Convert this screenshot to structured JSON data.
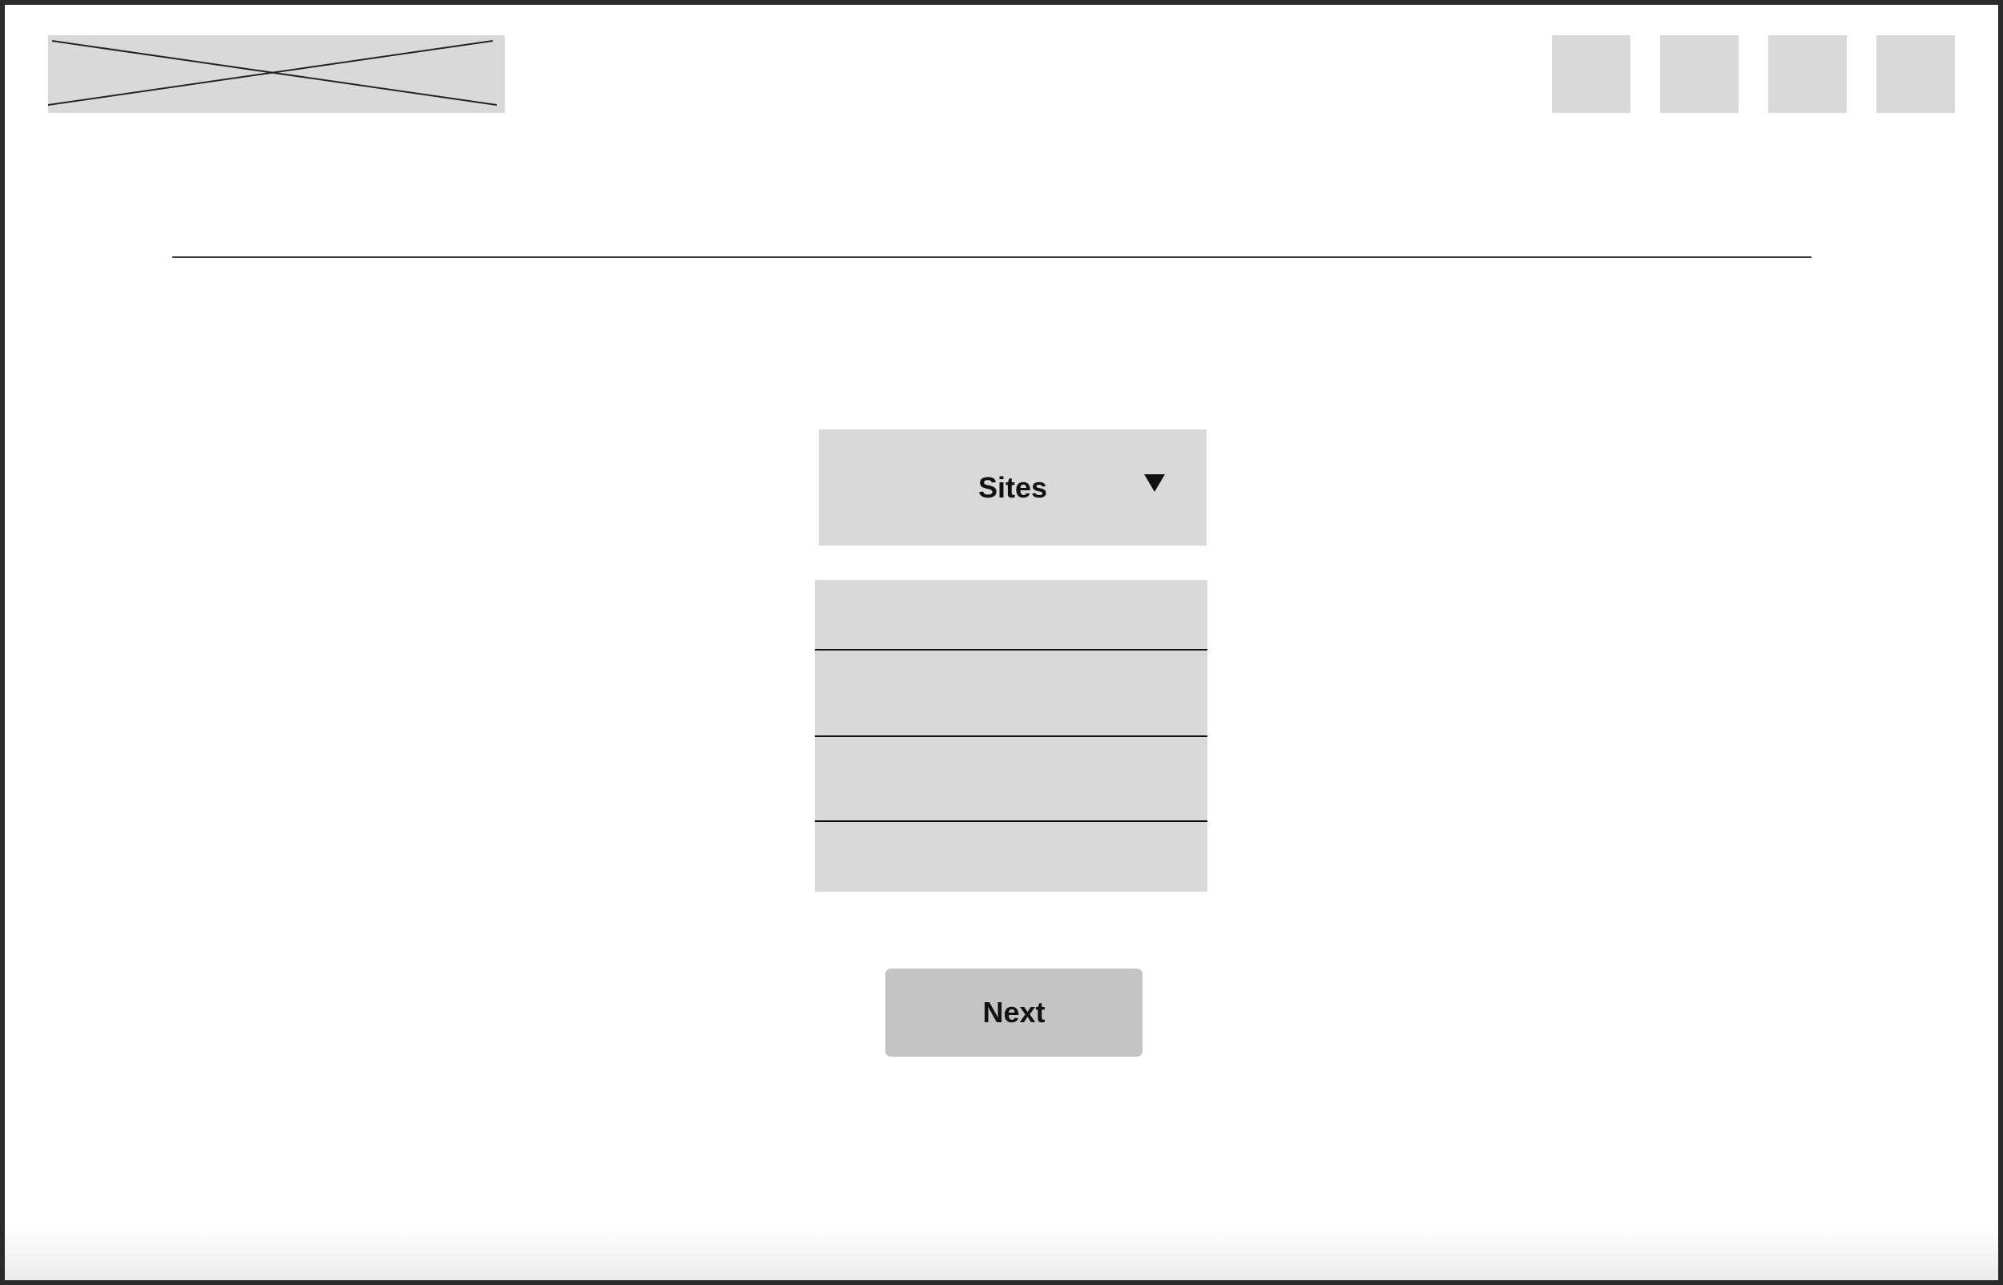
{
  "header": {
    "logo": {
      "kind": "image-placeholder"
    },
    "nav_items": [
      {
        "icon": "placeholder-square"
      },
      {
        "icon": "placeholder-square"
      },
      {
        "icon": "placeholder-square"
      },
      {
        "icon": "placeholder-square"
      }
    ]
  },
  "site_dropdown": {
    "selected_label": "Sites",
    "arrow_icon": "triangle-down-icon"
  },
  "site_list": {
    "items": [
      "",
      "",
      "",
      ""
    ]
  },
  "actions": {
    "next_label": "Next"
  },
  "colors": {
    "placeholder": "#d9d9d9",
    "button": "#c4c4c4",
    "text": "#111111",
    "background": "#ffffff"
  }
}
